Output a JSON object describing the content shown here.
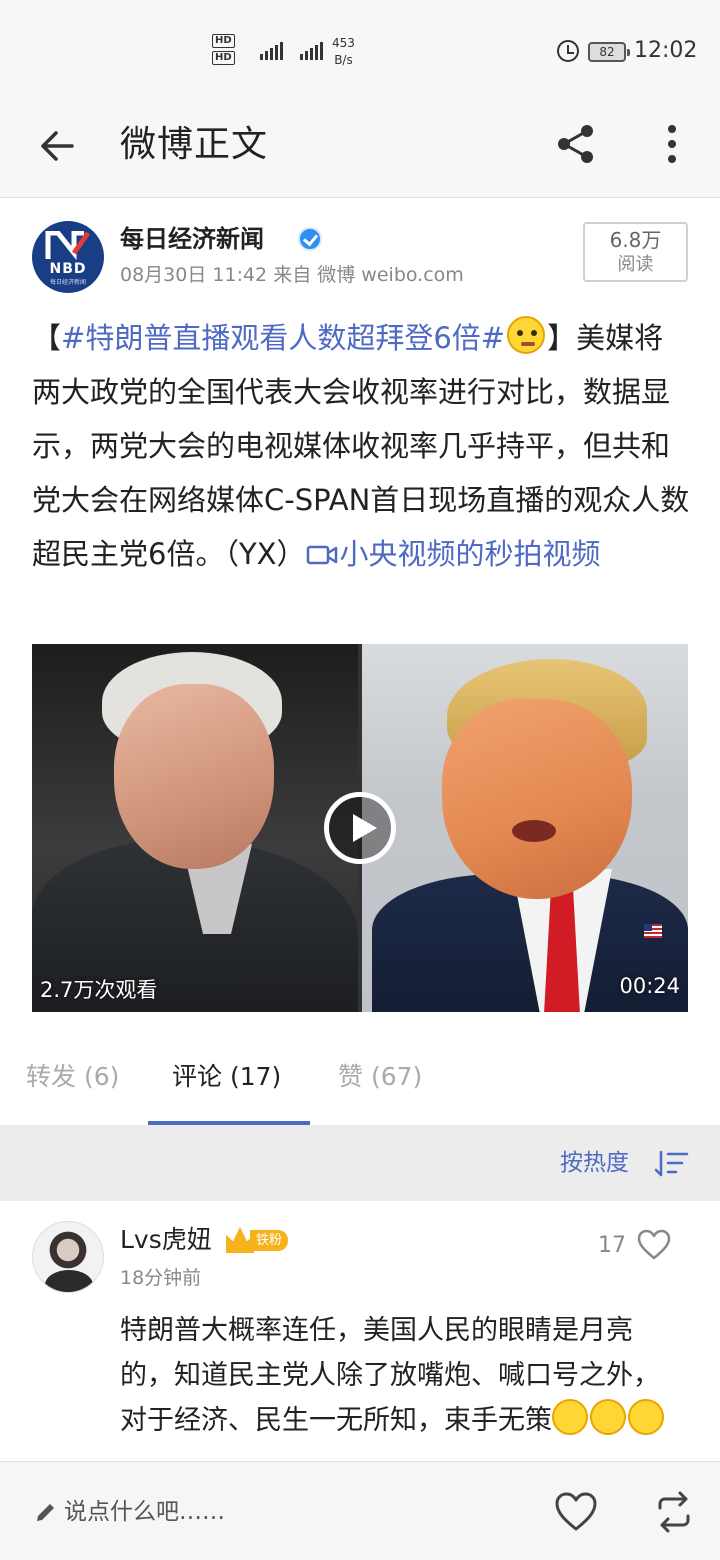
{
  "status_bar": {
    "hd1": "HD",
    "hd2": "HD",
    "sim1": "4G",
    "sim2": "4G",
    "speed_value": "453",
    "speed_unit": "B/s",
    "battery": "82",
    "time": "12:02"
  },
  "header": {
    "title": "微博正文",
    "icons": [
      "back-arrow-icon",
      "share-icon",
      "more-icon"
    ]
  },
  "post": {
    "author": "每日经济新闻",
    "avatar_text": "NBD",
    "avatar_subtext": "每日经济新闻",
    "date": "08月30日 11:42",
    "source_prefix": "来自",
    "source": "微博 weibo.com",
    "read_count": "6.8万",
    "read_label": "阅读",
    "text_open_bracket": "【",
    "topic": "#特朗普直播观看人数超拜登6倍#",
    "text_body": "】美媒将两大政党的全国代表大会收视率进行对比，数据显示，两党大会的电视媒体收视率几乎持平，但共和党大会在网络媒体C-SPAN首日现场直播的观众人数超民主党6倍。（YX）",
    "video_link": "小央视频的秒拍视频",
    "video": {
      "views": "2.7万次观看",
      "duration": "00:24"
    }
  },
  "tabs": [
    {
      "label": "转发 (6)",
      "active": false
    },
    {
      "label": "评论 (17)",
      "active": true
    },
    {
      "label": "赞 (67)",
      "active": false
    }
  ],
  "sort": {
    "label": "按热度"
  },
  "comment": {
    "user": "Lvs虎妞",
    "badge": "铁粉",
    "time": "18分钟前",
    "likes": "17",
    "text": "特朗普大概率连任，美国人民的眼睛是月亮的，知道民主党人除了放嘴炮、喊口号之外，对于经济、民生一无所知，束手无策"
  },
  "bottom_bar": {
    "input_placeholder": "说点什么吧……"
  },
  "colors": {
    "link": "#4f6ac4",
    "verified": "#2f8ff1",
    "badge": "#f6b21b"
  }
}
